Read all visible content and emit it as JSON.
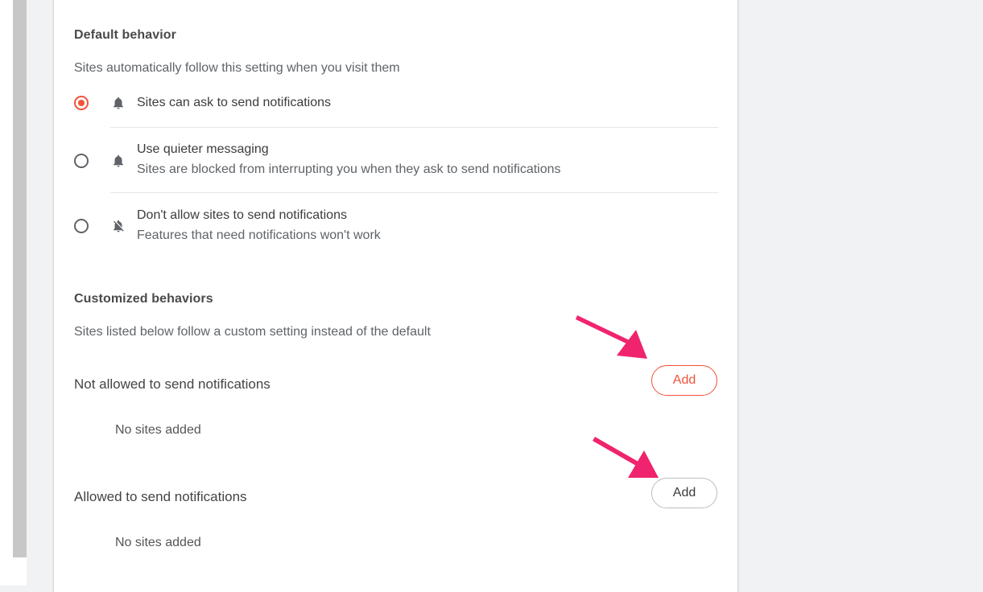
{
  "default_behavior": {
    "title": "Default behavior",
    "description": "Sites automatically follow this setting when you visit them",
    "options": [
      {
        "label": "Sites can ask to send notifications",
        "sublabel": "",
        "icon": "bell-icon",
        "selected": true
      },
      {
        "label": "Use quieter messaging",
        "sublabel": "Sites are blocked from interrupting you when they ask to send notifications",
        "icon": "bell-icon",
        "selected": false
      },
      {
        "label": "Don't allow sites to send notifications",
        "sublabel": "Features that need notifications won't work",
        "icon": "bell-off-icon",
        "selected": false
      }
    ]
  },
  "customized_behaviors": {
    "title": "Customized behaviors",
    "description": "Sites listed below follow a custom setting instead of the default",
    "not_allowed": {
      "label": "Not allowed to send notifications",
      "add_label": "Add",
      "empty_text": "No sites added"
    },
    "allowed": {
      "label": "Allowed to send notifications",
      "add_label": "Add",
      "empty_text": "No sites added"
    }
  },
  "colors": {
    "accent": "#f0533a",
    "annotation_arrow": "#f0246e",
    "background": "#f1f2f4"
  }
}
